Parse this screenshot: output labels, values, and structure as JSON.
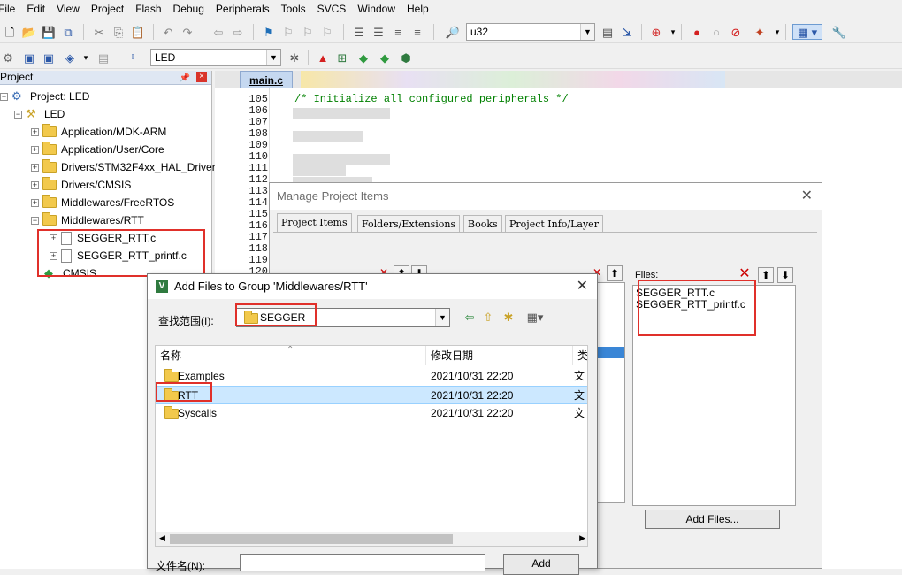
{
  "menubar": {
    "items": [
      "File",
      "Edit",
      "View",
      "Project",
      "Flash",
      "Debug",
      "Peripherals",
      "Tools",
      "SVCS",
      "Window",
      "Help"
    ]
  },
  "toolbar1": {
    "target_combo_value": "u32"
  },
  "toolbar2": {
    "target_select_value": "LED"
  },
  "project_panel": {
    "title": "Project",
    "tree": [
      {
        "label": "Project: LED",
        "kind": "project"
      },
      {
        "label": "LED",
        "kind": "target"
      },
      {
        "label": "Application/MDK-ARM",
        "kind": "group"
      },
      {
        "label": "Application/User/Core",
        "kind": "group"
      },
      {
        "label": "Drivers/STM32F4xx_HAL_Driver",
        "kind": "group"
      },
      {
        "label": "Drivers/CMSIS",
        "kind": "group"
      },
      {
        "label": "Middlewares/FreeRTOS",
        "kind": "group"
      },
      {
        "label": "Middlewares/RTT",
        "kind": "group"
      },
      {
        "label": "SEGGER_RTT.c",
        "kind": "file"
      },
      {
        "label": "SEGGER_RTT_printf.c",
        "kind": "file"
      },
      {
        "label": "CMSIS",
        "kind": "component"
      }
    ]
  },
  "editor": {
    "active_tab": "main.c",
    "line_numbers": [
      "105",
      "106",
      "107",
      "108",
      "109",
      "110",
      "111",
      "112",
      "113",
      "114",
      "115",
      "116",
      "117",
      "118",
      "119",
      "120"
    ],
    "first_line_text": "/* Initialize all configured peripherals */"
  },
  "manage_dialog": {
    "title": "Manage Project Items",
    "tabs": [
      "Project Items",
      "Folders/Extensions",
      "Books",
      "Project Info/Layer"
    ],
    "files_label": "Files:",
    "files": [
      "SEGGER_RTT.c",
      "SEGGER_RTT_printf.c"
    ],
    "add_files_button": "Add Files..."
  },
  "addfiles_dialog": {
    "title": "Add Files to Group 'Middlewares/RTT'",
    "lookin_label": "查找范围(I):",
    "lookin_value": "SEGGER",
    "columns": {
      "name": "名称",
      "date": "修改日期",
      "type": "类"
    },
    "rows": [
      {
        "name": "Examples",
        "date": "2021/10/31 22:20",
        "type": "文"
      },
      {
        "name": "RTT",
        "date": "2021/10/31 22:20",
        "type": "文"
      },
      {
        "name": "Syscalls",
        "date": "2021/10/31 22:20",
        "type": "文"
      }
    ],
    "filename_label": "文件名(N):",
    "add_button": "Add"
  },
  "colors": {
    "highlight": "#e0302a",
    "selection": "#cce8ff",
    "code_comment": "#008000"
  }
}
